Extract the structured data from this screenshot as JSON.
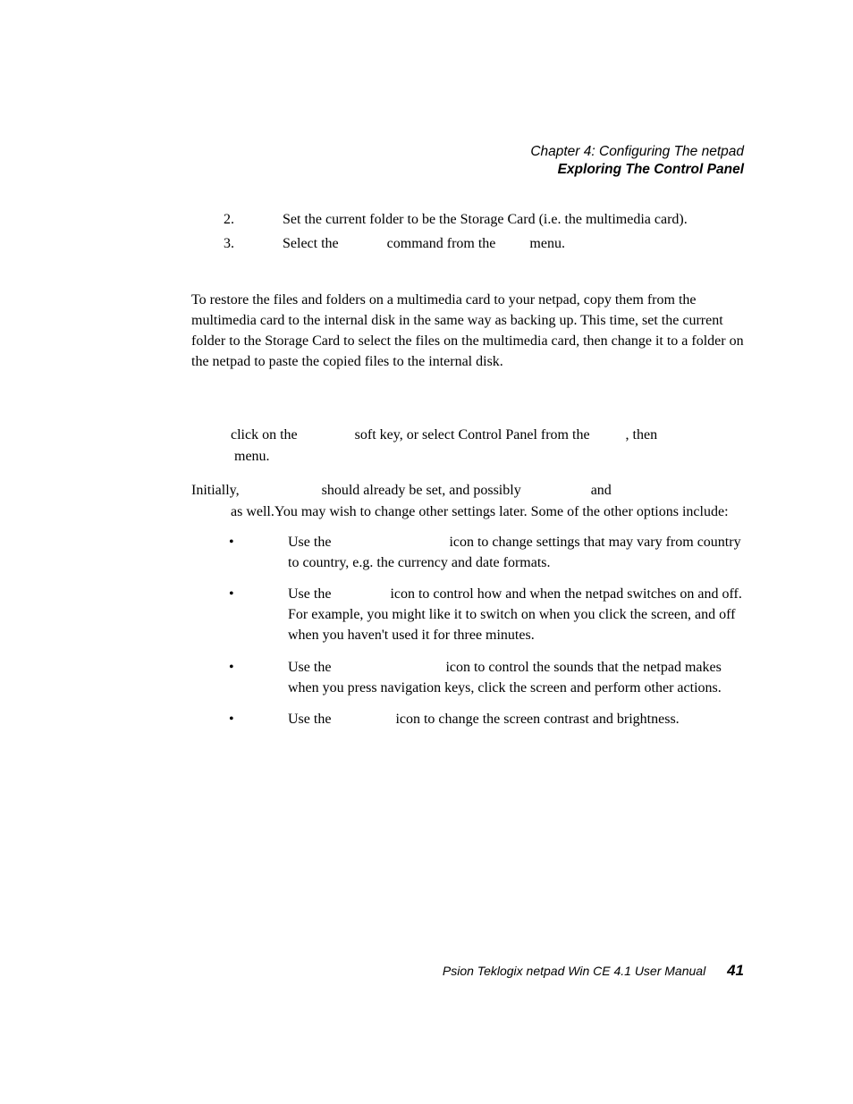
{
  "header": {
    "chapter": "Chapter 4:  Configuring The netpad",
    "subtitle": "Exploring The Control Panel"
  },
  "list": {
    "n2": "2.",
    "t2": "Set the current folder to be the Storage Card (i.e. the multimedia card).",
    "n3": "3.",
    "t3a": "Select the ",
    "t3b": " command from the ",
    "t3c": " menu."
  },
  "restore": "To restore the files and folders on a multimedia card to your netpad, copy them from the multimedia card to the internal disk in the same way as backing up. This time, set the current folder to the Storage Card to select the files on the multimedia card, then change it to a folder on the netpad to paste the copied files to the internal disk.",
  "indent": {
    "a": "click on the ",
    "b": " soft key, or select Control Panel from the ",
    "c": ", then ",
    "d": " menu."
  },
  "initial": {
    "a": "Initially, ",
    "b": " should already be set, and possibly ",
    "c": " and ",
    "d": " as well.You may wish to change other settings later. Some of the other options include:"
  },
  "bullets": {
    "b1a": "Use the ",
    "b1b": " icon to change settings that may vary from country to country, e.g. the currency and date formats.",
    "b2a": "Use the ",
    "b2b": " icon to control how and when the netpad switches on and off. For example, you might like it to switch on when you click the screen, and off when you haven't used it for three minutes.",
    "b3a": "Use the ",
    "b3b": " icon to control the sounds that the netpad makes when you press navigation keys, click the screen and perform other actions.",
    "b4a": "Use the ",
    "b4b": " icon to change the screen contrast and brightness."
  },
  "footer": {
    "title": "Psion Teklogix netpad Win CE 4.1 User Manual",
    "page": "41"
  }
}
